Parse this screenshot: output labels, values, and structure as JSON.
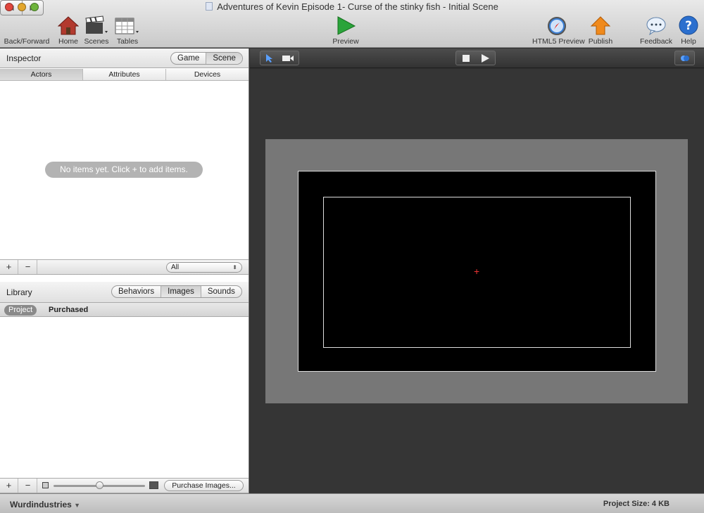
{
  "window": {
    "title": "Adventures of Kevin Episode 1- Curse of the stinky fish - Initial Scene"
  },
  "toolbar": {
    "back_forward": "Back/Forward",
    "home": "Home",
    "scenes": "Scenes",
    "tables": "Tables",
    "preview": "Preview",
    "html5_preview": "HTML5 Preview",
    "publish": "Publish",
    "feedback": "Feedback",
    "help": "Help"
  },
  "inspector": {
    "title": "Inspector",
    "mode_tabs": [
      "Game",
      "Scene"
    ],
    "selected_mode": "Scene",
    "tabs": [
      "Actors",
      "Attributes",
      "Devices"
    ],
    "selected_tab": "Actors",
    "empty_message": "No items yet. Click + to add items.",
    "add": "+",
    "remove": "−",
    "filter_value": "All"
  },
  "library": {
    "title": "Library",
    "tabs": [
      "Behaviors",
      "Images",
      "Sounds"
    ],
    "selected_tab": "Images",
    "sub_tabs": [
      "Project",
      "Purchased"
    ],
    "selected_sub": "Project",
    "add": "+",
    "remove": "−",
    "purchase_button": "Purchase Images...",
    "thumb_size_fraction": 0.5
  },
  "status": {
    "user": "Wurdindustries",
    "project_size": "Project Size: 4 KB"
  },
  "colors": {
    "close": "#e0463d",
    "minimize": "#e3a62c",
    "zoom": "#6eb43c",
    "preview_green": "#2aa43a",
    "publish_orange": "#f08a1c",
    "help_blue": "#2b6fce"
  }
}
